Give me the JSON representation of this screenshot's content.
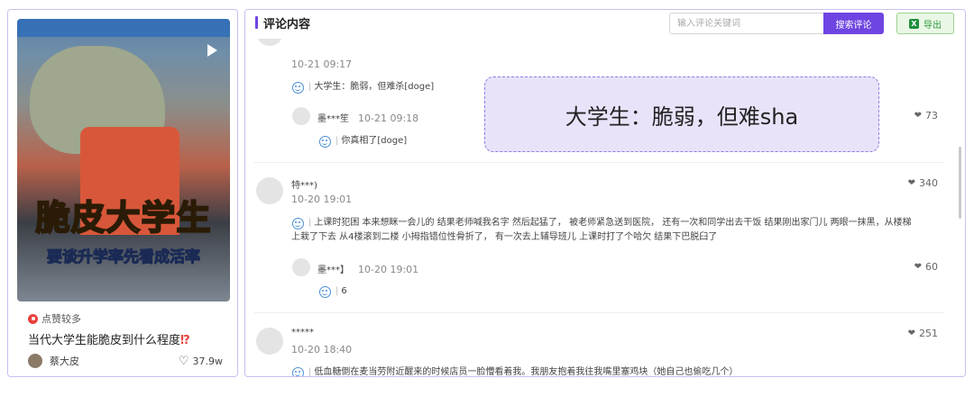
{
  "video_card": {
    "thumbnail_title": "脆皮大学生",
    "thumbnail_subtitle": "要谈升学率先看成活率",
    "badge": "点赞较多",
    "title": "当代大学生能脆皮到什么程度",
    "title_mark": "⁉",
    "author": "蔡大皮",
    "likes": "37.9w",
    "colors": {
      "accent": "#e8413d",
      "subtitle": "#ffe12b"
    }
  },
  "panel": {
    "title": "评论内容",
    "search_placeholder": "输入评论关键词",
    "search_button": "搜索评论",
    "export_button": "导出",
    "export_icon": "excel-icon",
    "accent": "#6e45e2"
  },
  "comments": [
    {
      "time": "10-21 09:17",
      "text": "大学生：脆弱，但难杀[doge]",
      "reply": {
        "name": "墨***笙",
        "time": "10-21 09:18",
        "likes": "73",
        "text": "你真相了[doge]"
      }
    },
    {
      "name": "特***)",
      "time": "10-20 19:01",
      "likes": "340",
      "text_line1": "上课时犯困 本来想眯一会儿的 结果老师喊我名字 然后起猛了， 被老师紧急送到医院， 还有一次和同学出去干饭 结果刚出家门儿 两眼一抹黑，从楼梯",
      "text_line2": "上栽了下去 从4楼滚到二楼 小拇指错位性骨折了， 有一次去上辅导班儿 上课时打了个哈欠 结果下巴脱臼了",
      "reply": {
        "name": "墨***】",
        "time": "10-20 19:01",
        "likes": "60",
        "text": "6"
      }
    },
    {
      "name": "*****",
      "time": "10-20 18:40",
      "likes": "251",
      "text": "低血糖倒在麦当劳附近醒来的时候店员一脸懵看着我。我朋友抱着我往我嘴里塞鸡块（她自己也偷吃几个）"
    }
  ],
  "tooltip": {
    "text": "大学生：脆弱，但难sha"
  }
}
